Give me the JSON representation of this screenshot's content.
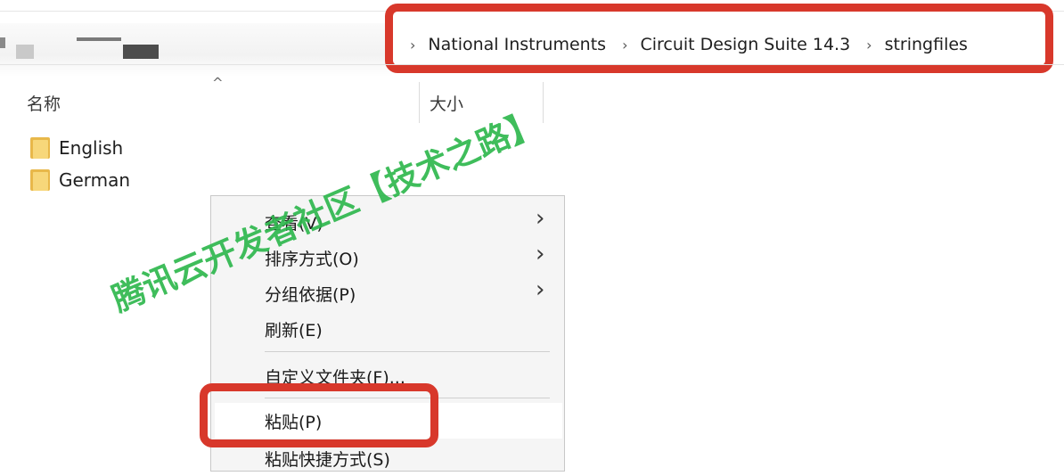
{
  "address_bar": {
    "breadcrumbs": [
      "National Instruments",
      "Circuit Design Suite 14.3",
      "stringfiles"
    ],
    "separator": "›"
  },
  "columns": {
    "name": "名称",
    "size": "大小",
    "sort_indicator": "^"
  },
  "files": [
    {
      "name": "English",
      "icon": "folder-icon"
    },
    {
      "name": "German",
      "icon": "folder-icon"
    }
  ],
  "context_menu": {
    "items": [
      {
        "label": "查看(V)",
        "has_submenu": true
      },
      {
        "label": "排序方式(O)",
        "has_submenu": true
      },
      {
        "label": "分组依据(P)",
        "has_submenu": true
      },
      {
        "label": "刷新(E)",
        "has_submenu": false
      },
      {
        "label": "自定义文件夹(F)...",
        "has_submenu": false
      },
      {
        "label": "粘贴(P)",
        "has_submenu": false
      },
      {
        "label": "粘贴快捷方式(S)",
        "has_submenu": false
      }
    ],
    "submenu_arrow": "›"
  },
  "watermark": "腾讯云开发者社区【技术之路】",
  "colors": {
    "highlight": "#d8382b",
    "watermark": "#2fb84e",
    "folder": "#f7d77a"
  }
}
